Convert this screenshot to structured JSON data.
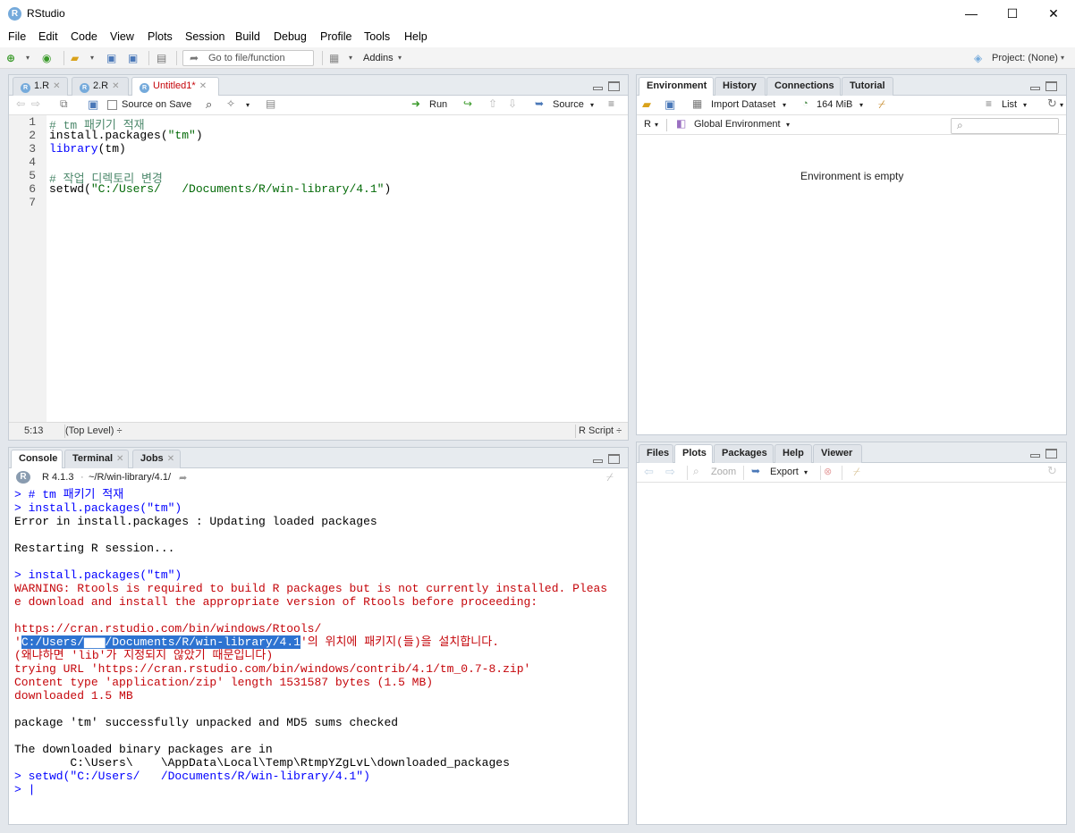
{
  "window": {
    "title": "RStudio",
    "app_icon": "R",
    "minimize_glyph": "—",
    "maximize_glyph": "☐",
    "close_glyph": "✕"
  },
  "menu": [
    "File",
    "Edit",
    "Code",
    "View",
    "Plots",
    "Session",
    "Build",
    "Debug",
    "Profile",
    "Tools",
    "Help"
  ],
  "toolbar": {
    "goto_placeholder": "Go to file/function",
    "addins_label": "Addins",
    "project_label": "Project: (None)"
  },
  "editor": {
    "tabs": [
      {
        "label": "1.R",
        "active": false,
        "modified": false
      },
      {
        "label": "2.R",
        "active": false,
        "modified": false
      },
      {
        "label": "Untitled1*",
        "active": true,
        "modified": true
      }
    ],
    "source_on_save_label": "Source on Save",
    "run_label": "Run",
    "source_label": "Source",
    "lines": [
      {
        "no": "1",
        "text": "# tm 패키기 적재",
        "style": "comment"
      },
      {
        "no": "2",
        "text": "install.packages(\"tm\")",
        "style": "plain"
      },
      {
        "no": "3",
        "text": "library(tm)",
        "style": "kw"
      },
      {
        "no": "4",
        "text": "",
        "style": "plain"
      },
      {
        "no": "5",
        "text": "# 작업 디렉토리 변경",
        "style": "comment"
      },
      {
        "no": "6",
        "text": "setwd(\"C:/Users/   /Documents/R/win-library/4.1\")",
        "style": "plain"
      },
      {
        "no": "7",
        "text": "",
        "style": "plain"
      }
    ],
    "status": {
      "cursor": "5:13",
      "scope": "(Top Level) ÷",
      "file_type": "R Script ÷"
    }
  },
  "console_pane": {
    "tabs": [
      {
        "label": "Console",
        "active": true
      },
      {
        "label": "Terminal",
        "active": false
      },
      {
        "label": "Jobs",
        "active": false
      }
    ],
    "r_version": "R 4.1.3",
    "working_dir": "~/R/win-library/4.1/",
    "lines": [
      {
        "text": "> # tm 패키기 적재",
        "style": "cmd"
      },
      {
        "text": "> install.packages(\"tm\")",
        "style": "cmd"
      },
      {
        "text": "Error in install.packages : Updating loaded packages",
        "style": "out"
      },
      {
        "text": "",
        "style": "out"
      },
      {
        "text": "Restarting R session...",
        "style": "out"
      },
      {
        "text": "",
        "style": "out"
      },
      {
        "text": "> install.packages(\"tm\")",
        "style": "cmd"
      },
      {
        "text": "WARNING: Rtools is required to build R packages but is not currently installed. Pleas",
        "style": "err"
      },
      {
        "text": "e download and install the appropriate version of Rtools before proceeding:",
        "style": "err"
      },
      {
        "text": "",
        "style": "out"
      },
      {
        "text": "https://cran.rstudio.com/bin/windows/Rtools/",
        "style": "err"
      },
      {
        "text": "SELECTION_LINE",
        "style": "sel"
      },
      {
        "text": "(왜냐하면 'lib'가 지정되지 않았기 때문입니다)",
        "style": "err"
      },
      {
        "text": "trying URL 'https://cran.rstudio.com/bin/windows/contrib/4.1/tm_0.7-8.zip'",
        "style": "err"
      },
      {
        "text": "Content type 'application/zip' length 1531587 bytes (1.5 MB)",
        "style": "err"
      },
      {
        "text": "downloaded 1.5 MB",
        "style": "err"
      },
      {
        "text": "",
        "style": "out"
      },
      {
        "text": "package 'tm' successfully unpacked and MD5 sums checked",
        "style": "out"
      },
      {
        "text": "",
        "style": "out"
      },
      {
        "text": "The downloaded binary packages are in",
        "style": "out"
      },
      {
        "text": "        C:\\Users\\    \\AppData\\Local\\Temp\\RtmpYZgLvL\\downloaded_packages",
        "style": "out"
      },
      {
        "text": "> setwd(\"C:/Users/   /Documents/R/win-library/4.1\")",
        "style": "cmd"
      },
      {
        "text": "> |",
        "style": "cmd"
      }
    ],
    "selection_prefix": "'",
    "selection_text": "C:/Users/▆▆▆/Documents/R/win-library/4.1",
    "selection_suffix": "'의 위치에 패키지(들)을 설치합니다."
  },
  "env_pane": {
    "tabs": [
      {
        "label": "Environment",
        "active": true
      },
      {
        "label": "History",
        "active": false
      },
      {
        "label": "Connections",
        "active": false
      },
      {
        "label": "Tutorial",
        "active": false
      }
    ],
    "import_label": "Import Dataset",
    "memory_label": "164 MiB",
    "list_label": "List",
    "lang_label": "R",
    "scope_label": "Global Environment",
    "empty_message": "Environment is empty"
  },
  "files_pane": {
    "tabs": [
      {
        "label": "Files",
        "active": false
      },
      {
        "label": "Plots",
        "active": true
      },
      {
        "label": "Packages",
        "active": false
      },
      {
        "label": "Help",
        "active": false
      },
      {
        "label": "Viewer",
        "active": false
      }
    ],
    "zoom_label": "Zoom",
    "export_label": "Export"
  }
}
